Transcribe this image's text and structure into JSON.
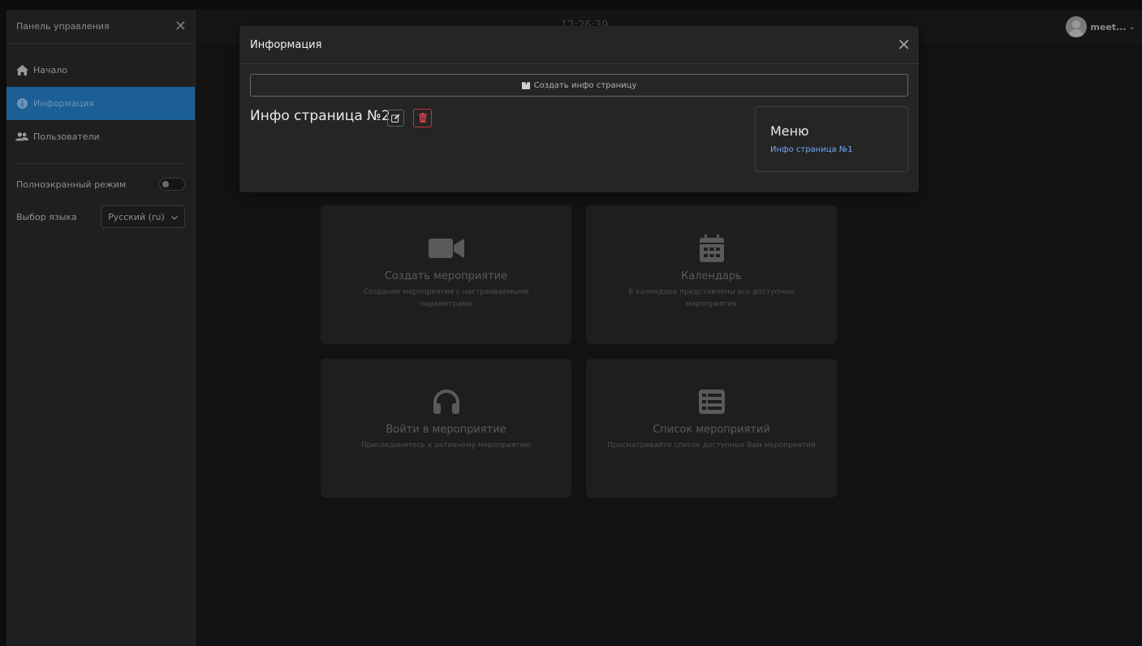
{
  "sidebar": {
    "title": "Панель управления",
    "items": [
      {
        "label": "Начало",
        "icon": "home-icon"
      },
      {
        "label": "Информация",
        "icon": "info-icon"
      },
      {
        "label": "Пользователи",
        "icon": "users-icon"
      }
    ],
    "fullscreen_label": "Полноэкранный режим",
    "language_label": "Выбор языка",
    "language_value": "Русский (ru)"
  },
  "topbar": {
    "clock": "12:26:39",
    "username": "meet..."
  },
  "cards": [
    {
      "title": "Создать мероприятие",
      "desc": "Создание мероприятия с настраиваемыми параметрами",
      "icon": "video-camera-icon"
    },
    {
      "title": "Календарь",
      "desc": "В календаре представлены все доступные мероприятия",
      "icon": "calendar-icon"
    },
    {
      "title": "Войти в мероприятие",
      "desc": "Присоединитесь к активному мероприятию",
      "icon": "headphones-icon"
    },
    {
      "title": "Список мероприятий",
      "desc": "Просматривайте список доступных Вам мероприятий",
      "icon": "list-icon"
    }
  ],
  "modal": {
    "title": "Информация",
    "create_label": "Создать инфо страницу",
    "page_title": "Инфо страница №2",
    "menu_title": "Меню",
    "menu_link": "Инфо страница №1"
  },
  "colors": {
    "accent": "#1b5f96",
    "link": "#6ea8fe",
    "danger": "#c0343f",
    "background": "#121212",
    "modal_bg": "#252525"
  }
}
